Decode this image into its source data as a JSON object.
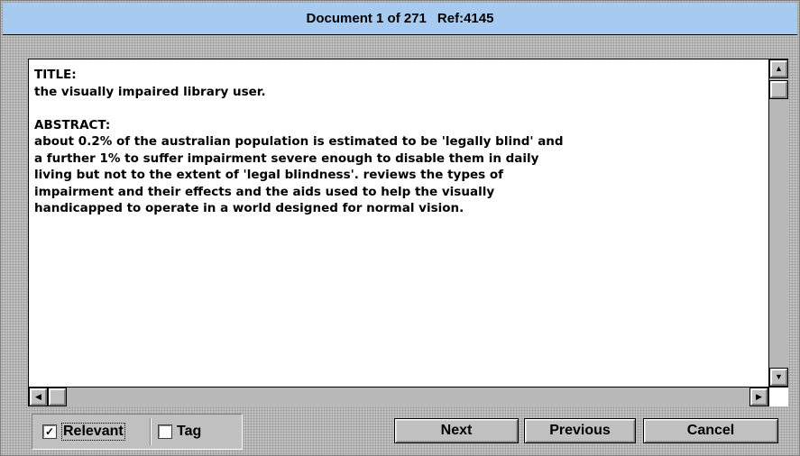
{
  "window": {
    "title": "Document 1 of 271",
    "ref": "Ref:4145"
  },
  "document": {
    "text": "TITLE:\nthe visually impaired library user.\n\nABSTRACT:\nabout 0.2% of the australian population is estimated to be 'legally blind' and\na further 1% to suffer impairment severe enough to disable them in daily\nliving but not to the extent of 'legal blindness'. reviews the types of\nimpairment and their effects and the aids used to help the visually\nhandicapped to operate in a world designed for normal vision."
  },
  "scrollbars": {
    "up_icon": "arrow-up-icon",
    "down_icon": "arrow-down-icon",
    "left_icon": "arrow-left-icon",
    "right_icon": "arrow-right-icon"
  },
  "options": {
    "relevant": {
      "label": "Relevant",
      "checked": true,
      "mark": "✓"
    },
    "tag": {
      "label": "Tag",
      "checked": false
    }
  },
  "buttons": {
    "next": "Next",
    "previous": "Previous",
    "cancel": "Cancel"
  }
}
